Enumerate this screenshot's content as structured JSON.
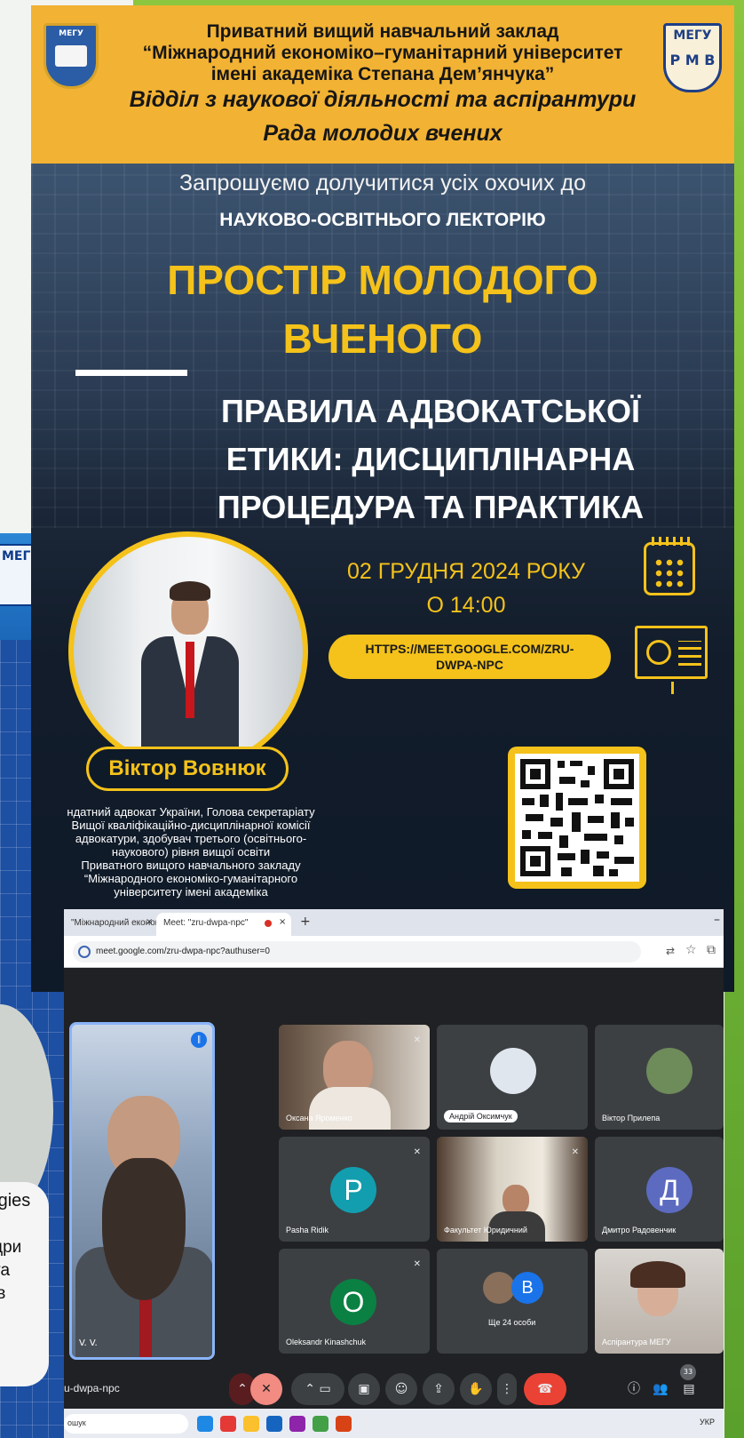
{
  "poster": {
    "header": {
      "line1": "Приватний вищий навчальний заклад",
      "line2": "“Міжнародний економіко–гуманітарний університет",
      "line3": "імені академіка Степана Дем’янчука”",
      "line4": "Відділ з наукової діяльності та аспірантури",
      "line5": "Рада молодих вчених",
      "logo_right_text": "МЕГУ",
      "logo_right_letters": "Р М В",
      "logo_left_text": "МЕГУ"
    },
    "invite": "Запрошуємо долучитися усіх охочих до",
    "lectorium": "НАУКОВО-ОСВІТНЬОГО ЛЕКТОРІЮ",
    "title_line1": "ПРОСТІР МОЛОДОГО",
    "title_line2": "ВЧЕНОГО",
    "topic_line1": "ПРАВИЛА АДВОКАТСЬКОЇ",
    "topic_line2": "ЕТИКИ: ДИСЦИПЛІНАРНА",
    "topic_line3": "ПРОЦЕДУРА ТА ПРАКТИКА",
    "date_line1": "02 ГРУДНЯ 2024 РОКУ",
    "date_line2": "О 14:00",
    "link_line1": "HTTPS://MEET.GOOGLE.COM/ZRU-",
    "link_line2": "DWPA-NPC",
    "speaker_name": "Віктор Вовнюк",
    "bio_line1": "ндатний адвокат України, Голова секретаріату",
    "bio_line2": "Вищої кваліфікаційно-дисциплінарної комісії",
    "bio_line3": "адвокатури, здобувач третього (освітнього-",
    "bio_line4": "наукового) рівня вищої освіти",
    "bio_line5": "Приватного вищого навчального закладу",
    "bio_line6": "“Міжнародного економіко-гуманітарного",
    "bio_line7": "університету імені академіка"
  },
  "background_slide": {
    "logo_text": "МЕГУ",
    "text1": "logies",
    "text2": "дри",
    "text3": "та",
    "text4": "ів"
  },
  "browser": {
    "tab1_title": "\"Міжнародний економі",
    "tab2_title": "Meet: \"zru-dwpa-npc\"",
    "close_glyph": "×",
    "new_tab_glyph": "+",
    "minimize_glyph": "–",
    "url": "meet.google.com/zru-dwpa-npc?authuser=0"
  },
  "meet": {
    "speaker_name": "V. V.",
    "participants": [
      {
        "name": "Оксана Яроменко"
      },
      {
        "name": "Андрій Оксимчук"
      },
      {
        "name": "Віктор Прилепа"
      },
      {
        "name": "Pasha Ridik",
        "initial": "P"
      },
      {
        "name": "Факультет Юридичний"
      },
      {
        "name": "Дмитро Радовенчик",
        "initial": "Д"
      },
      {
        "name": "Oleksandr Kinashchuk",
        "initial": "O"
      },
      {
        "name": "Ще 24 особи",
        "initial": "B"
      },
      {
        "name": "Аспірантура МЕГУ"
      }
    ],
    "meeting_code": "u-dwpa-npc",
    "participant_count": "33",
    "taskbar_search": "ошук",
    "tray_lang": "УКР"
  },
  "colors": {
    "accent_yellow": "#f4c21a",
    "header_orange": "#f2b233",
    "meet_bg": "#202124",
    "tile_bg": "#3c4043",
    "end_call_red": "#ea4335",
    "green_edge": "#8cc63f"
  },
  "icons": {
    "calendar": "calendar-icon",
    "presentation": "presentation-board-icon",
    "mic_off": "mic-off-icon",
    "end_call": "end-call-icon"
  }
}
